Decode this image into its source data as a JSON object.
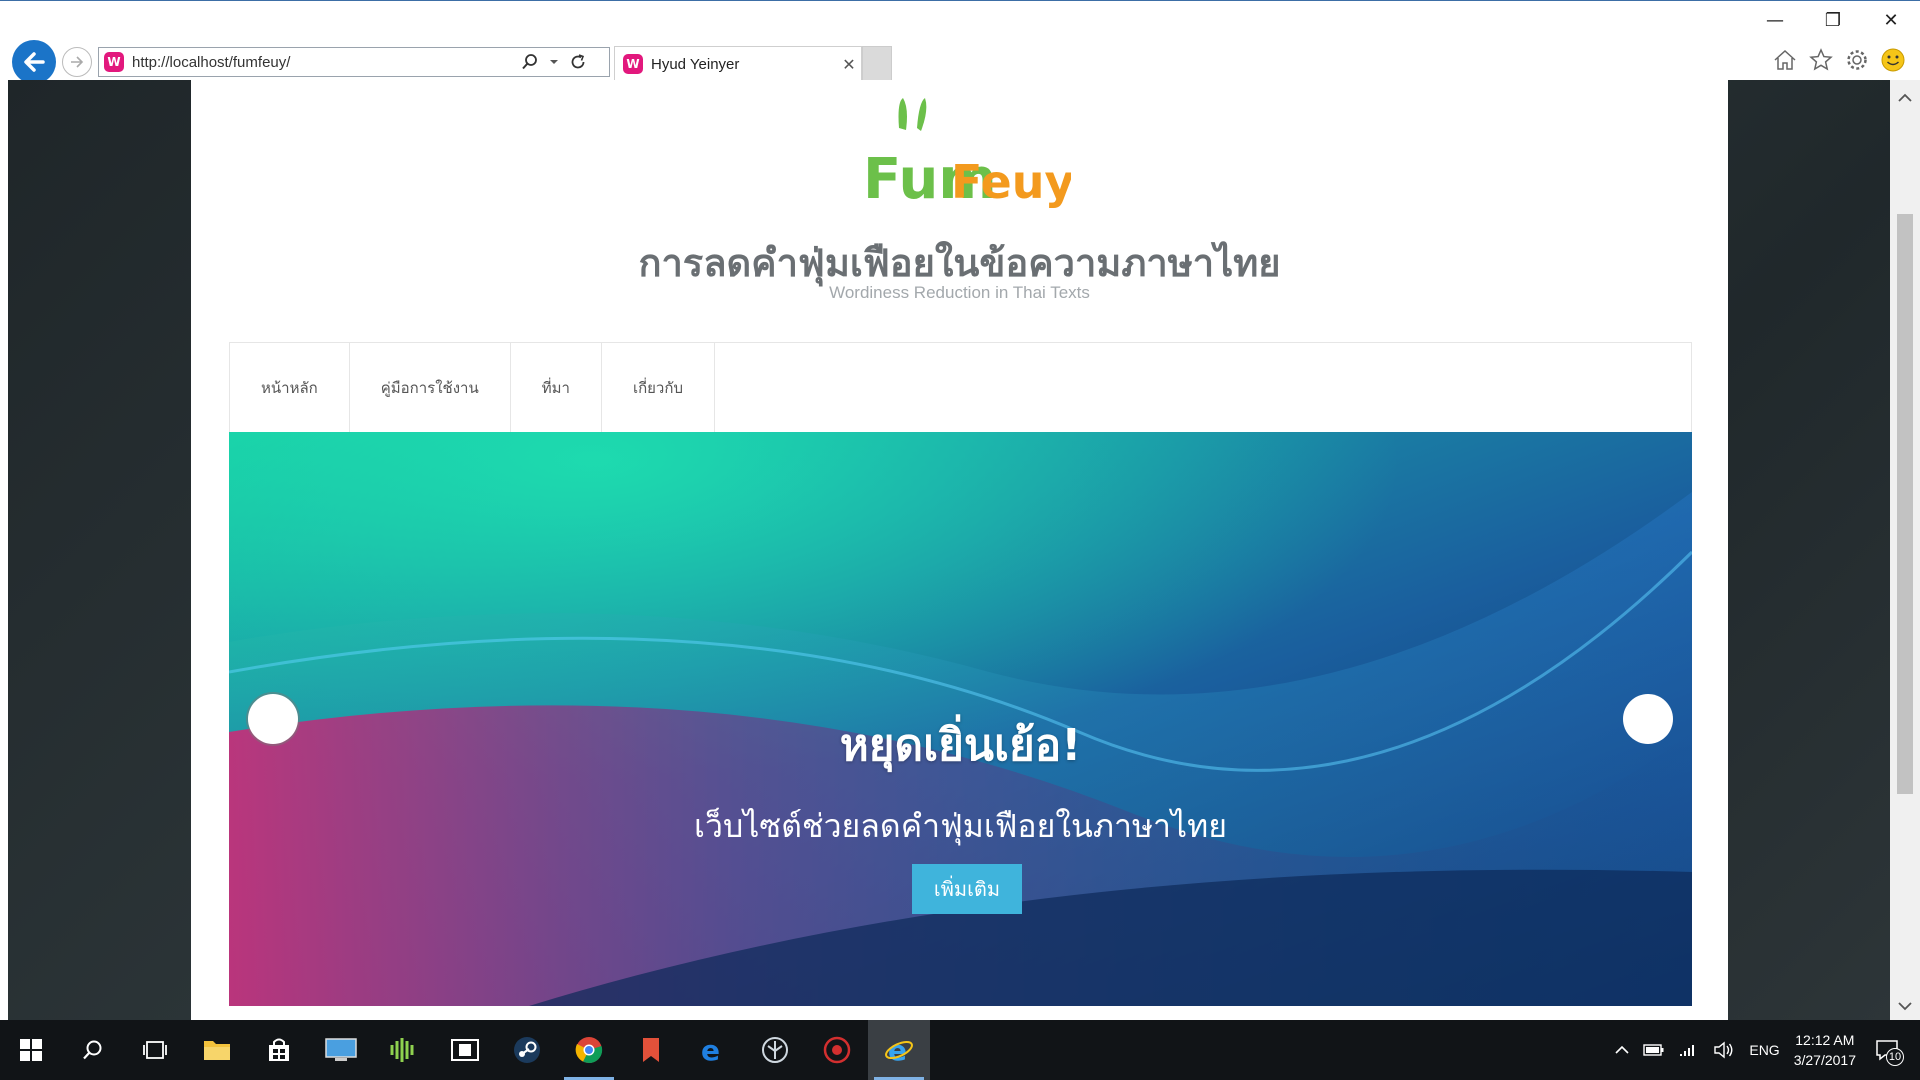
{
  "browser": {
    "url": "http://localhost/fumfeuy/",
    "tab_title": "Hyud Yeinyer",
    "favicon_letter": "W",
    "window_controls": [
      "minimize-icon",
      "restore-icon",
      "close-icon"
    ],
    "toolbar_icons": [
      "home-icon",
      "star-icon",
      "gear-icon",
      "smiley-icon"
    ]
  },
  "site": {
    "logo_text_1": "Fum",
    "logo_text_2": "Feuy",
    "title": "การลดคำฟุ่มเฟือยในข้อความภาษาไทย",
    "tagline": "Wordiness Reduction in Thai Texts"
  },
  "nav": {
    "items": [
      {
        "label": "หน้าหลัก"
      },
      {
        "label": "คู่มือการใช้งาน"
      },
      {
        "label": "ที่มา"
      },
      {
        "label": "เกี่ยวกับ"
      }
    ]
  },
  "slider": {
    "heading": "หยุดเยิ่นเย้อ!",
    "subheading": "เว็บไซต์ช่วยลดคำฟุ่มเฟือยในภาษาไทย",
    "button_label": "เพิ่มเติม"
  },
  "taskbar": {
    "apps": [
      "windows-start-icon",
      "search-icon",
      "task-view-icon",
      "file-explorer-icon",
      "store-icon",
      "remote-desktop-icon",
      "audio-app-icon",
      "media-app-icon",
      "steam-icon",
      "chrome-icon",
      "app-icon",
      "edge-icon",
      "app-icon",
      "app-icon",
      "internet-explorer-icon"
    ],
    "language": "ENG",
    "time": "12:12 AM",
    "date": "3/27/2017",
    "notification_count": "10"
  },
  "colors": {
    "browser_back": "#1b74c8",
    "favicon": "#e2187d",
    "logo_green": "#6cc04a",
    "logo_orange": "#f39a1e",
    "slide_button": "#3fb4dc",
    "page_background": "#242c2f"
  }
}
